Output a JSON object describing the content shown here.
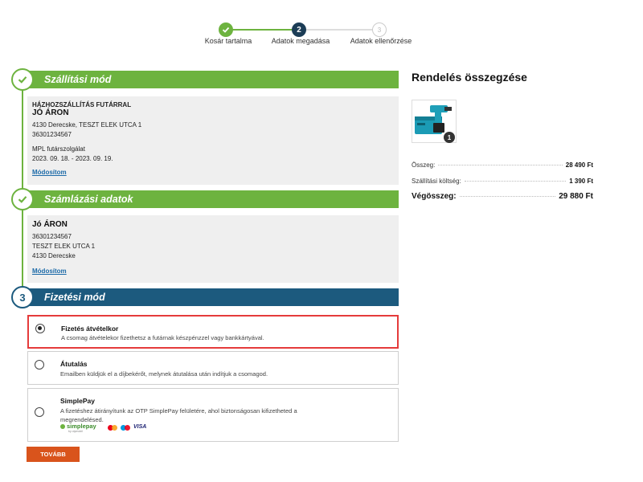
{
  "stepper": {
    "steps": [
      {
        "label": "Kosár tartalma",
        "number": "1",
        "state": "done"
      },
      {
        "label": "Adatok megadása",
        "number": "2",
        "state": "active"
      },
      {
        "label": "Adatok ellenőrzése",
        "number": "3",
        "state": "pending"
      }
    ]
  },
  "shipping": {
    "title": "Szállítási mód",
    "method": "HÁZHOZSZÁLLÍTÁS FUTÁRRAL",
    "name": "JÓ ÁRON",
    "address": "4130 Derecske, TESZT ELEK UTCA 1",
    "phone": "36301234567",
    "carrier": "MPL futárszolgálat",
    "dates": "2023. 09. 18. - 2023. 09. 19.",
    "edit_label": "Módosítom"
  },
  "billing": {
    "title": "Számlázási adatok",
    "name": "Jó ÁRON",
    "phone": "36301234567",
    "street": "TESZT ELEK UTCA 1",
    "city": "4130 Derecske",
    "edit_label": "Módosítom"
  },
  "payment": {
    "number": "3",
    "title": "Fizetési mód",
    "options": [
      {
        "title": "Fizetés átvételkor",
        "desc": "A csomag átvételekor fizethetsz a futárnak készpénzzel vagy bankkártyával.",
        "selected": true
      },
      {
        "title": "Átutalás",
        "desc": "Emailben küldjük el a díjbekérőt, melynek átutalása után indítjuk a csomagod.",
        "selected": false
      },
      {
        "title": "SimplePay",
        "desc": "A fizetéshez átirányítunk az OTP SimplePay felületére, ahol biztonságosan kifizetheted a megrendelésed.",
        "selected": false
      }
    ],
    "simplepay_logo": "simplepay",
    "simplepay_sub": "by otpmobil",
    "visa_label": "VISA"
  },
  "next_button": "TOVÁBB",
  "summary": {
    "title": "Rendelés összegzése",
    "qty": "1",
    "rows": [
      {
        "label": "Összeg:",
        "value": "28 490 Ft"
      },
      {
        "label": "Szállítási költség:",
        "value": "1 390 Ft"
      }
    ],
    "total_label": "Végösszeg:",
    "total_value": "29 880 Ft"
  },
  "colors": {
    "green": "#6db33f",
    "blue": "#1c5a7e",
    "orange": "#d9541c",
    "selected_border": "#e53b3b"
  }
}
